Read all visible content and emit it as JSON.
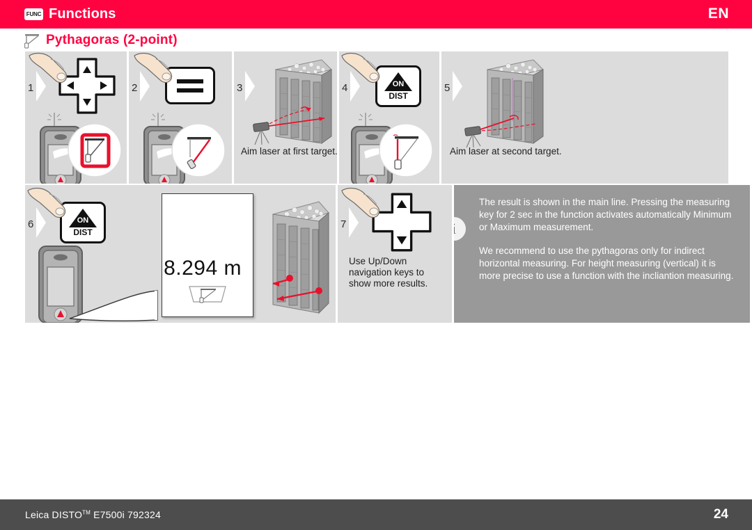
{
  "header": {
    "func_badge": "FUNC",
    "title": "Functions",
    "language": "EN"
  },
  "subtitle": {
    "icon": "pythagoras-icon",
    "text": "Pythagoras (2-point)"
  },
  "steps": [
    {
      "number": "1",
      "key_icon": "navigation-dpad-icon",
      "caption": "",
      "device_display": "pythagoras-function-selected"
    },
    {
      "number": "2",
      "key_icon": "equals-key-icon",
      "caption": "",
      "device_display": "pythagoras-measure-leg"
    },
    {
      "number": "3",
      "key_icon": "",
      "caption": "Aim laser at first target.",
      "device_display": "building-facade-first-target"
    },
    {
      "number": "4",
      "key_icon": "on-dist-key-icon",
      "caption": "",
      "device_display": "pythagoras-first-measured"
    },
    {
      "number": "5",
      "key_icon": "",
      "caption": "Aim laser at second target.",
      "device_display": "building-facade-second-target"
    },
    {
      "number": "6",
      "key_icon": "on-dist-key-icon",
      "caption": "",
      "device_display": "result-display"
    },
    {
      "number": "7",
      "key_icon": "navigation-updown-icon",
      "caption": "Use Up/Down navigation keys to show more results.",
      "device_display": "building-facade-result-distance"
    }
  ],
  "keys": {
    "on_label": "ON",
    "dist_label": "DIST"
  },
  "result": {
    "value": "8.294 m",
    "icon": "pythagoras-icon"
  },
  "info": {
    "badge": "i",
    "paragraph_1": "The result is shown in the main line. Pressing the measuring key for 2 sec in the function activates automatically Minimum or Maximum measurement.",
    "paragraph_2": "We recommend to use the pythagoras only for indirect horizontal measuring. For height measuring (vertical) it is more precise to use a function with the incliantion measuring."
  },
  "footer": {
    "product": "Leica DISTO",
    "trademark": "TM",
    "model": "E7500i 792324",
    "page_number": "24"
  },
  "colors": {
    "brand_red": "#ff0341",
    "panel_gray": "#dcdcdc",
    "info_gray": "#999999",
    "footer_gray": "#4d4d4d",
    "laser_red": "#e8112d"
  }
}
